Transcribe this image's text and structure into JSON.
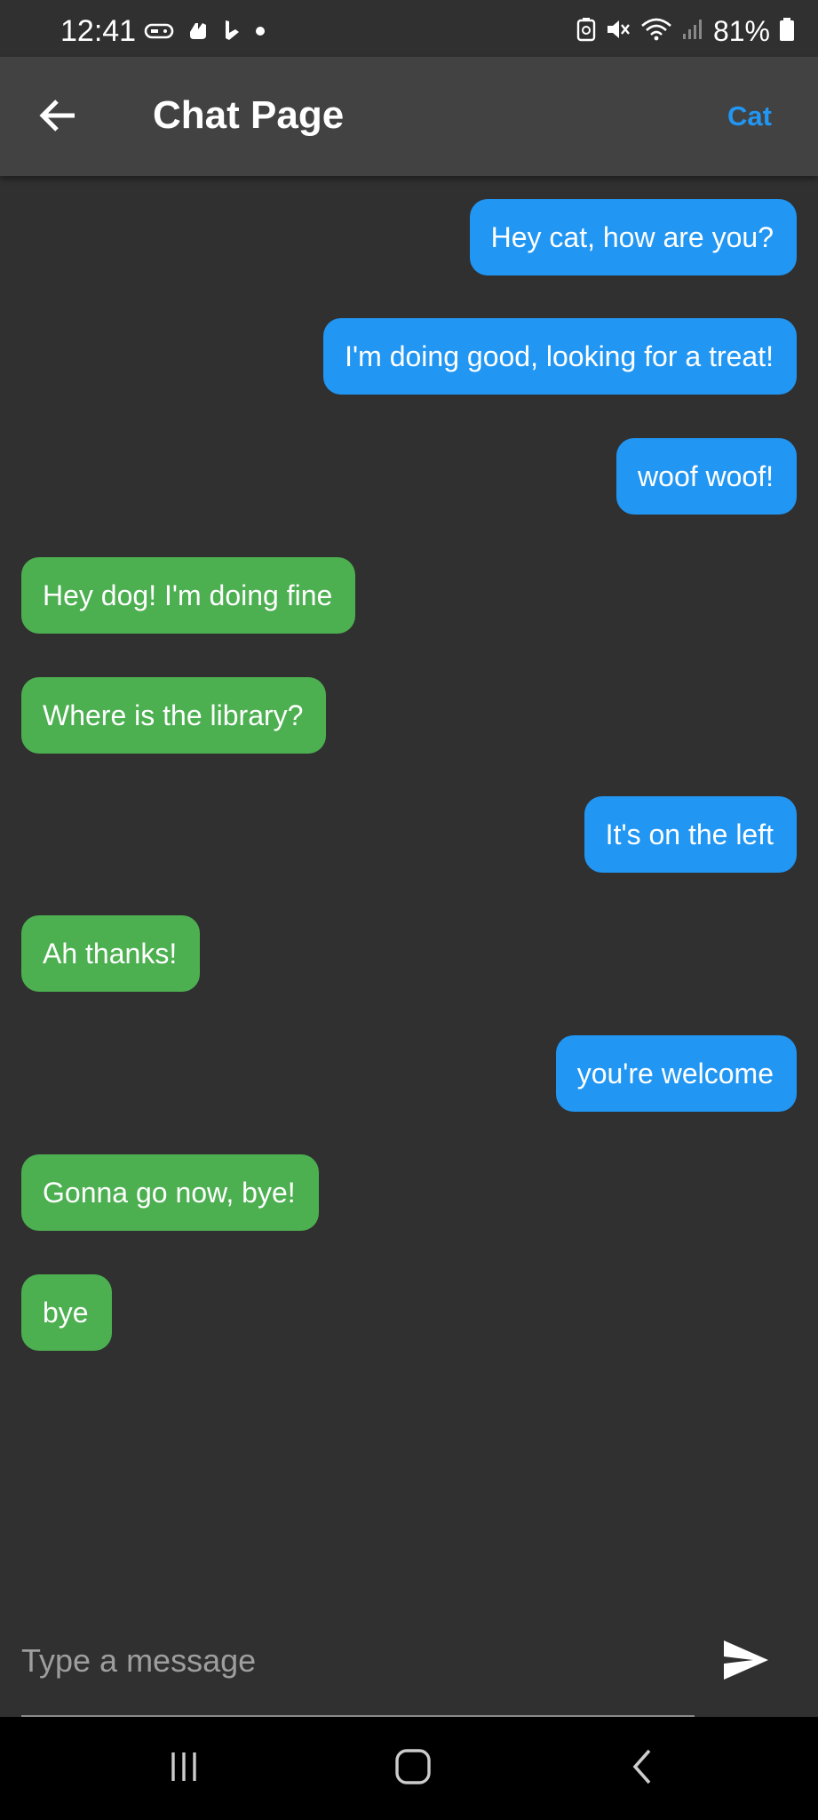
{
  "status_bar": {
    "time": "12:41",
    "battery_percent": "81%",
    "left_icons": [
      "game-controller-icon",
      "doordash-icon",
      "bing-icon",
      "dot-icon"
    ],
    "right_icons": [
      "battery-saver-icon",
      "mute-icon",
      "wifi-icon",
      "signal-icon",
      "battery-icon"
    ]
  },
  "app_bar": {
    "title": "Chat Page",
    "action_label": "Cat",
    "back_icon": "arrow-back-icon"
  },
  "messages": [
    {
      "text": "Hey cat, how are you?",
      "side": "sent"
    },
    {
      "text": "I'm doing good, looking for a treat!",
      "side": "sent"
    },
    {
      "text": "woof woof!",
      "side": "sent"
    },
    {
      "text": "Hey dog! I'm doing fine",
      "side": "received"
    },
    {
      "text": "Where is the library?",
      "side": "received"
    },
    {
      "text": "It's on the left",
      "side": "sent"
    },
    {
      "text": "Ah thanks!",
      "side": "received"
    },
    {
      "text": "you're welcome",
      "side": "sent"
    },
    {
      "text": "Gonna go now, bye!",
      "side": "received"
    },
    {
      "text": "bye",
      "side": "received"
    }
  ],
  "input": {
    "placeholder": "Type a message",
    "value": "",
    "send_icon": "send-icon"
  },
  "nav_bar": {
    "buttons": [
      "recent-apps-icon",
      "home-icon",
      "back-chevron-icon"
    ]
  },
  "colors": {
    "background": "#303030",
    "app_bar": "#424242",
    "sent_bubble": "#2196f3",
    "received_bubble": "#4caf50",
    "accent": "#2196f3"
  }
}
